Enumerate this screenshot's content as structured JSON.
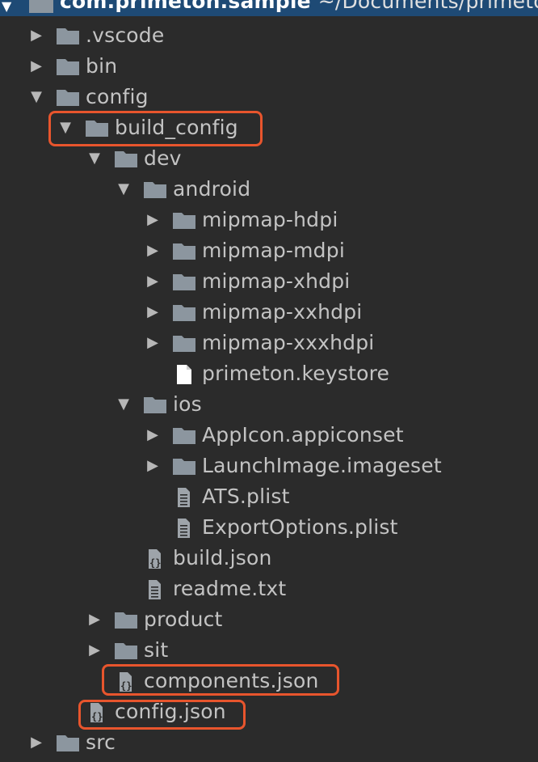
{
  "header": {
    "project_name": "com.primeton.sample",
    "project_path": "~/Documents/primeton"
  },
  "tree": [
    {
      "label": ".vscode",
      "type": "folder",
      "expanded": false
    },
    {
      "label": "bin",
      "type": "folder",
      "expanded": false
    },
    {
      "label": "config",
      "type": "folder",
      "expanded": true
    },
    {
      "label": "build_config",
      "type": "folder",
      "expanded": true,
      "highlighted": true
    },
    {
      "label": "dev",
      "type": "folder",
      "expanded": true
    },
    {
      "label": "android",
      "type": "folder",
      "expanded": true
    },
    {
      "label": "mipmap-hdpi",
      "type": "folder",
      "expanded": false
    },
    {
      "label": "mipmap-mdpi",
      "type": "folder",
      "expanded": false
    },
    {
      "label": "mipmap-xhdpi",
      "type": "folder",
      "expanded": false
    },
    {
      "label": "mipmap-xxhdpi",
      "type": "folder",
      "expanded": false
    },
    {
      "label": "mipmap-xxxhdpi",
      "type": "folder",
      "expanded": false
    },
    {
      "label": "primeton.keystore",
      "type": "file"
    },
    {
      "label": "ios",
      "type": "folder",
      "expanded": true
    },
    {
      "label": "AppIcon.appiconset",
      "type": "folder",
      "expanded": false
    },
    {
      "label": "LaunchImage.imageset",
      "type": "folder",
      "expanded": false
    },
    {
      "label": "ATS.plist",
      "type": "text-file"
    },
    {
      "label": "ExportOptions.plist",
      "type": "text-file"
    },
    {
      "label": "build.json",
      "type": "json-file"
    },
    {
      "label": "readme.txt",
      "type": "text-file"
    },
    {
      "label": "product",
      "type": "folder",
      "expanded": false
    },
    {
      "label": "sit",
      "type": "folder",
      "expanded": false
    },
    {
      "label": "components.json",
      "type": "json-file",
      "highlighted": true
    },
    {
      "label": "config.json",
      "type": "json-file",
      "highlighted": true
    },
    {
      "label": "src",
      "type": "folder",
      "expanded": false
    }
  ],
  "colors": {
    "background": "#2b2b2b",
    "header": "#1e4a75",
    "folder": "#8c969f",
    "text": "#c3c3c3",
    "highlight": "#e8552d"
  },
  "icons": {
    "folder": "folder-icon",
    "file": "file-icon",
    "text-file": "text-file-icon",
    "json-file": "json-file-icon",
    "collapsed": "chevron-right-icon",
    "expanded": "chevron-down-icon"
  }
}
